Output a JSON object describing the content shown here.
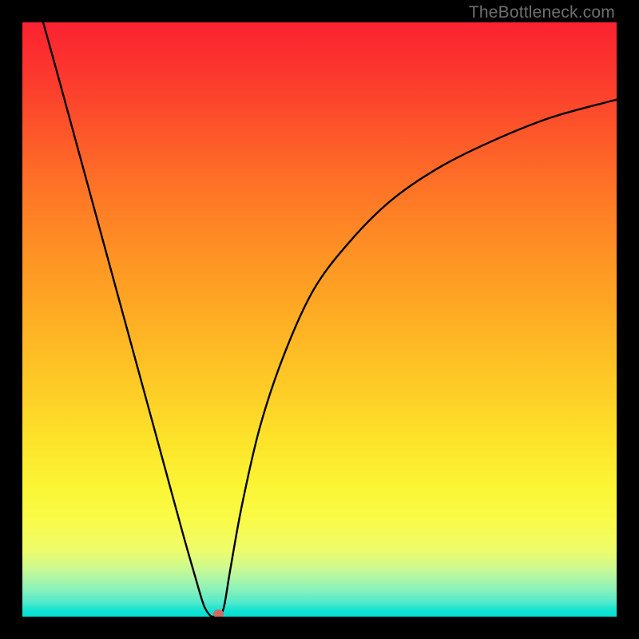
{
  "watermark": "TheBottleneck.com",
  "chart_data": {
    "type": "line",
    "title": "",
    "xlabel": "",
    "ylabel": "",
    "x_range": [
      0,
      100
    ],
    "y_range": [
      0,
      100
    ],
    "grid": false,
    "series": [
      {
        "name": "curve",
        "x": [
          3.5,
          6,
          9,
          12,
          15,
          18,
          21,
          24,
          27,
          29,
          30.5,
          31.5,
          32.2,
          33.3,
          34,
          35,
          37,
          40,
          44,
          49,
          55,
          62,
          70,
          79,
          89,
          100
        ],
        "y": [
          100,
          91,
          80,
          69,
          58,
          47,
          36,
          25,
          14,
          7,
          2,
          0.3,
          0,
          0.3,
          2,
          8,
          19,
          32,
          44,
          55,
          63,
          70,
          75.5,
          80,
          84,
          87
        ]
      }
    ],
    "marker": {
      "x": 33.0,
      "y": 0.5,
      "color": "#ce6a62"
    },
    "background_gradient": [
      "#fb2230",
      "#fde22a",
      "#00e1d4"
    ]
  }
}
